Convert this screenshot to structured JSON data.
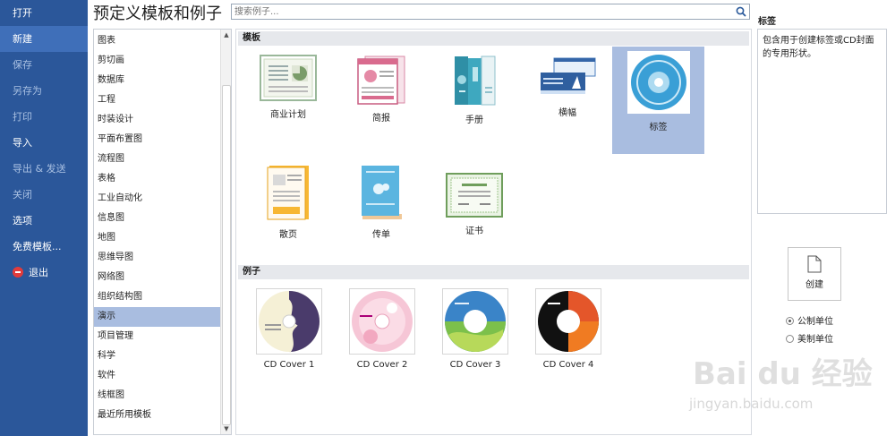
{
  "nav": {
    "items": [
      {
        "label": "打开",
        "state": "normal"
      },
      {
        "label": "新建",
        "state": "active"
      },
      {
        "label": "保存",
        "state": "dim"
      },
      {
        "label": "另存为",
        "state": "dim"
      },
      {
        "label": "打印",
        "state": "dim"
      },
      {
        "label": "导入",
        "state": "normal"
      },
      {
        "label": "导出 & 发送",
        "state": "dim"
      },
      {
        "label": "关闭",
        "state": "dim"
      },
      {
        "label": "选项",
        "state": "normal"
      },
      {
        "label": "免费模板...",
        "state": "normal"
      }
    ],
    "exit_label": "退出",
    "bg_color": "#2b579a",
    "active_color": "#3f6fb9"
  },
  "header": {
    "title": "预定义模板和例子"
  },
  "search": {
    "placeholder": "搜索例子..."
  },
  "categories": {
    "items": [
      "图表",
      "剪切画",
      "数据库",
      "工程",
      "时装设计",
      "平面布置图",
      "流程图",
      "表格",
      "工业自动化",
      "信息图",
      "地图",
      "思维导图",
      "网络图",
      "组织结构图",
      "演示",
      "项目管理",
      "科学",
      "软件",
      "线框图",
      "最近所用模板"
    ],
    "selected": "演示",
    "selected_color": "#a9bde0"
  },
  "templates": {
    "header": "模板",
    "items": [
      {
        "label": "商业计划",
        "icon": "business-plan-icon"
      },
      {
        "label": "简报",
        "icon": "newsletter-icon"
      },
      {
        "label": "手册",
        "icon": "brochure-icon"
      },
      {
        "label": "横幅",
        "icon": "banner-icon"
      },
      {
        "label": "标签",
        "icon": "cd-label-icon",
        "selected": true
      },
      {
        "label": "散页",
        "icon": "flyer-icon"
      },
      {
        "label": "传单",
        "icon": "leaflet-icon"
      },
      {
        "label": "证书",
        "icon": "certificate-icon"
      }
    ]
  },
  "examples": {
    "header": "例子",
    "items": [
      {
        "label": "CD Cover 1"
      },
      {
        "label": "CD Cover 2"
      },
      {
        "label": "CD Cover 3"
      },
      {
        "label": "CD Cover 4"
      }
    ]
  },
  "details": {
    "title": "标签",
    "description": "包含用于创建标签或CD封面的专用形状。"
  },
  "create": {
    "label": "创建"
  },
  "units": {
    "metric": "公制单位",
    "imperial": "美制单位",
    "selected": "metric"
  },
  "watermark": {
    "text": "Bai du 经验",
    "url": "jingyan.baidu.com"
  }
}
